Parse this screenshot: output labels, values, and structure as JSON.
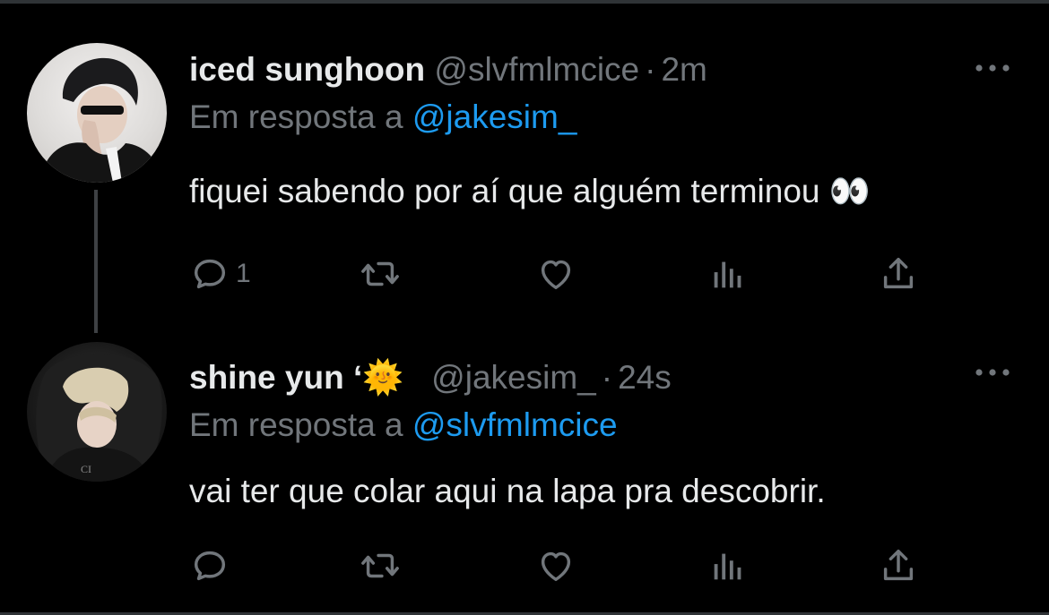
{
  "tweets": [
    {
      "display_name": "iced sunghoon",
      "handle": "@slvfmlmcice",
      "separator": "·",
      "time": "2m",
      "reply_prefix": "Em resposta a",
      "reply_to": "@jakesim_",
      "text": "fiquei sabendo por aí que alguém terminou 👀",
      "reply_count": "1",
      "retweet_count": "",
      "like_count": ""
    },
    {
      "display_name": "shine yun ‘🌞",
      "handle": "@jakesim_",
      "separator": "·",
      "time": "24s",
      "reply_prefix": "Em resposta a",
      "reply_to": "@slvfmlmcice",
      "text": "vai ter que colar aqui na lapa pra descobrir.",
      "reply_count": "",
      "retweet_count": "",
      "like_count": ""
    }
  ],
  "icons": {
    "reply": "reply-icon",
    "retweet": "retweet-icon",
    "like": "heart-icon",
    "views": "views-icon",
    "share": "share-icon",
    "more": "more-icon"
  },
  "colors": {
    "background": "#000000",
    "text": "#e7e9ea",
    "secondary": "#71767b",
    "mention": "#1d9bf0",
    "icon": "#71767b"
  }
}
